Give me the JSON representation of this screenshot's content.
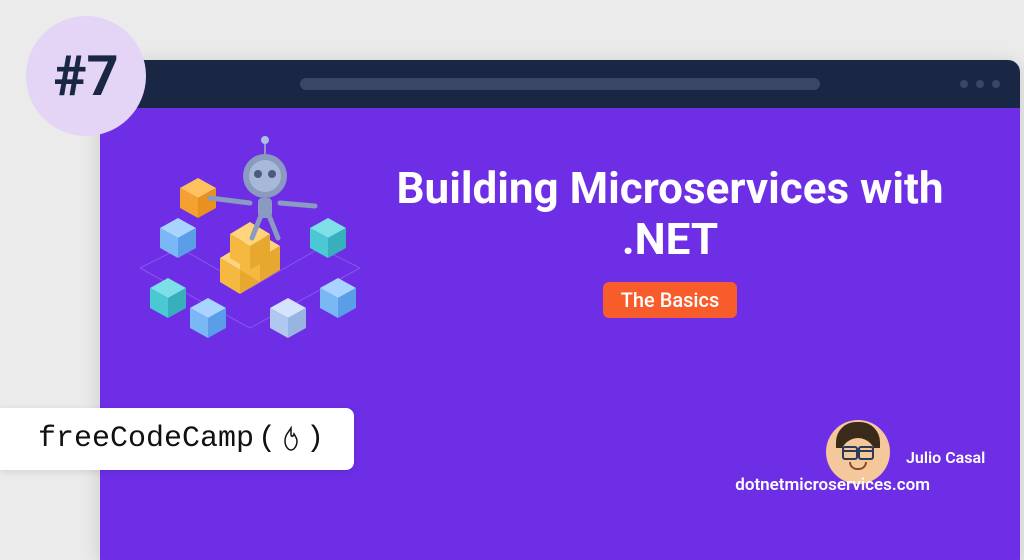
{
  "rank": "#7",
  "title": "Building Microservices with .NET",
  "badge": "The Basics",
  "author": "Julio Casal",
  "site": "dotnetmicroservices.com",
  "brand": "freeCodeCamp",
  "colors": {
    "bg": "#ebebeb",
    "window_header": "#1a2744",
    "content": "#6d2ee6",
    "badge": "#f95c2b",
    "circle": "#e4d5f7"
  }
}
